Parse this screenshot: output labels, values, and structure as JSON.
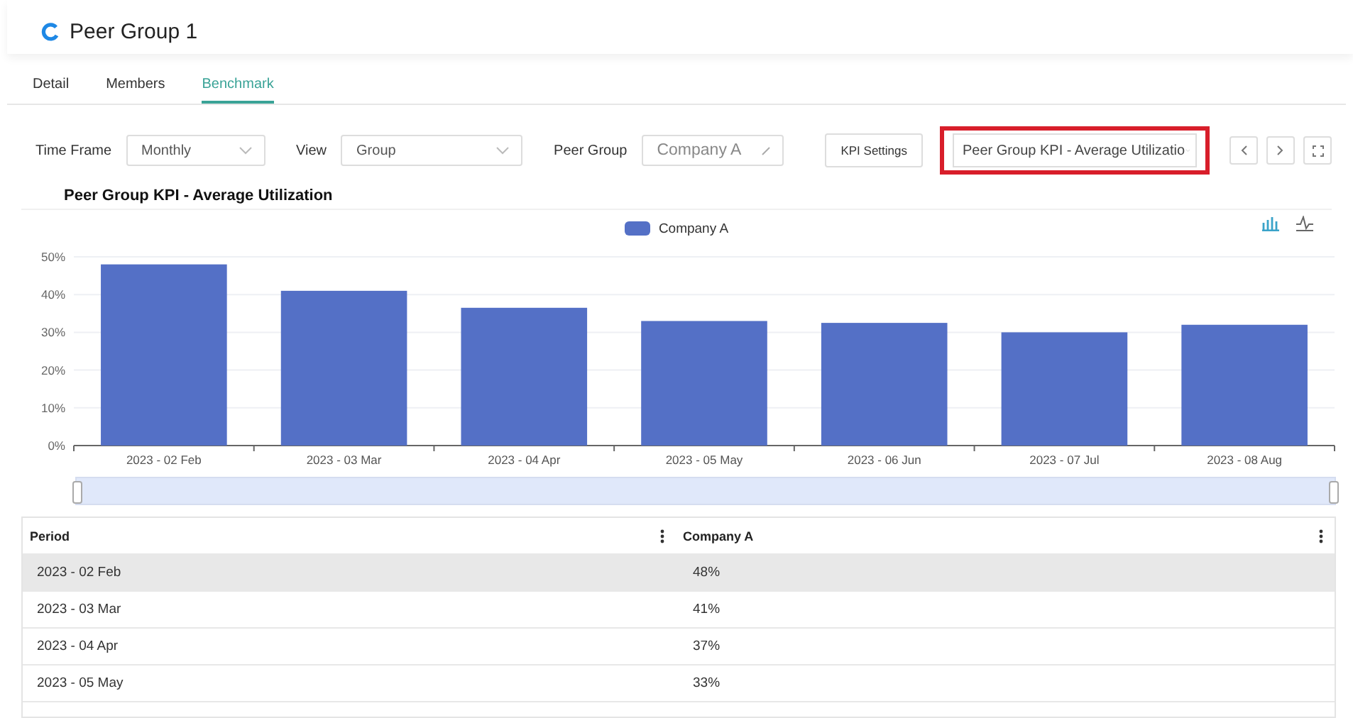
{
  "header": {
    "title": "Peer Group 1"
  },
  "tabs": [
    {
      "label": "Detail",
      "selected": false
    },
    {
      "label": "Members",
      "selected": false
    },
    {
      "label": "Benchmark",
      "selected": true
    }
  ],
  "filters": [
    {
      "label": "Time Frame",
      "value": "Monthly",
      "kind": "select"
    },
    {
      "label": "View",
      "value": "Group",
      "kind": "select"
    },
    {
      "label": "Peer Group",
      "value": "Company A",
      "kind": "edit"
    }
  ],
  "kpi_settings": "KPI Settings",
  "kpi_select": {
    "value": "Peer Group KPI - Average Utilizatio",
    "highlighted": true
  },
  "chart_title": "Peer Group KPI - Average Utilization",
  "zoom_slider": {
    "level": 1
  },
  "chart_data": {
    "type": "bar",
    "grid": true,
    "categories": [
      "2023 - 02 Feb",
      "2023 - 03 Mar",
      "2023 - 04 Apr",
      "2023 - 05 May",
      "2023 - 06 Jun",
      "2023 - 07 Jul",
      "2023 - 08 Aug"
    ],
    "series": [
      {
        "name": "Company A",
        "color": "#5470c6",
        "values": [
          48,
          41,
          36.5,
          33,
          32.5,
          30,
          32
        ]
      }
    ],
    "ylim": [
      0,
      50
    ],
    "yticks": [
      {
        "value": 0,
        "label": "0%"
      },
      {
        "value": 10,
        "label": "10%"
      },
      {
        "value": 20,
        "label": "20%"
      },
      {
        "value": 30,
        "label": "30%"
      },
      {
        "value": 40,
        "label": "40%"
      },
      {
        "value": 50,
        "label": "50%"
      }
    ]
  },
  "table": {
    "columns": [
      "Period",
      "Company A"
    ],
    "rows": [
      {
        "cells": [
          "2023 - 02 Feb",
          "48%"
        ],
        "selected": true
      },
      {
        "cells": [
          "2023 - 03 Mar",
          "41%"
        ],
        "selected": false
      },
      {
        "cells": [
          "2023 - 04 Apr",
          "37%"
        ],
        "selected": false
      },
      {
        "cells": [
          "2023 - 05 May",
          "33%"
        ],
        "selected": false
      }
    ]
  }
}
